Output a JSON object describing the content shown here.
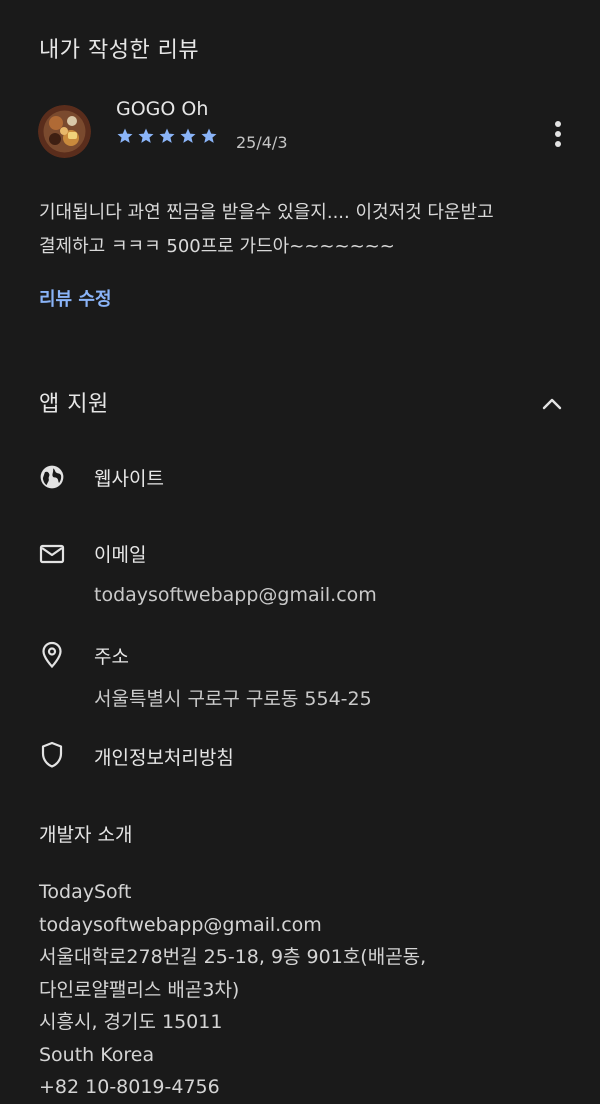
{
  "review_section": {
    "title": "내가 작성한 리뷰",
    "reviewer_name": "GOGO Oh",
    "rating": 5,
    "max_rating": 5,
    "date": "25/4/3",
    "text": "기대됩니다 과연 찐금을 받을수 있을지.... 이것저것 다운받고\n결제하고  ㅋㅋㅋ 500프로 가드아~~~~~~~",
    "edit_link": "리뷰 수정"
  },
  "app_support": {
    "title": "앱 지원",
    "items": [
      {
        "icon": "globe-icon",
        "label": "웹사이트",
        "value": ""
      },
      {
        "icon": "email-icon",
        "label": "이메일",
        "value": "todaysoftwebapp@gmail.com"
      },
      {
        "icon": "location-pin-icon",
        "label": "주소",
        "value": "서울특별시 구로구 구로동 554-25"
      },
      {
        "icon": "shield-icon",
        "label": "개인정보처리방침",
        "value": ""
      }
    ]
  },
  "developer": {
    "title": "개발자 소개",
    "lines": [
      "TodaySoft",
      "todaysoftwebapp@gmail.com",
      "서울대학로278번길 25-18, 9층 901호(배곧동,",
      "다인로얄팰리스 배곧3차)",
      "시흥시, 경기도 15011",
      "South Korea",
      "+82 10-8019-4756"
    ]
  },
  "colors": {
    "background": "#1a1a1a",
    "accent": "#8ab4f8",
    "text": "#e3e3e3"
  }
}
